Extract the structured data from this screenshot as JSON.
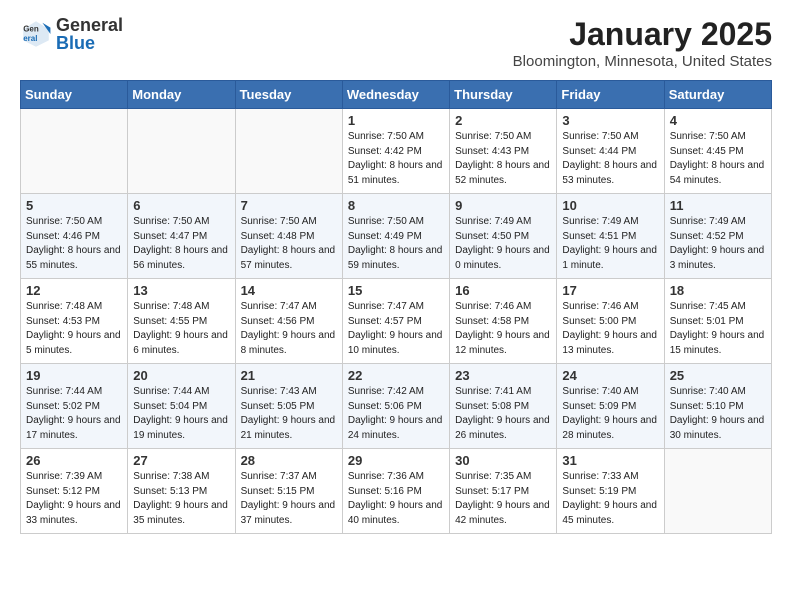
{
  "header": {
    "logo_general": "General",
    "logo_blue": "Blue",
    "month": "January 2025",
    "location": "Bloomington, Minnesota, United States"
  },
  "weekdays": [
    "Sunday",
    "Monday",
    "Tuesday",
    "Wednesday",
    "Thursday",
    "Friday",
    "Saturday"
  ],
  "weeks": [
    [
      {
        "day": "",
        "info": ""
      },
      {
        "day": "",
        "info": ""
      },
      {
        "day": "",
        "info": ""
      },
      {
        "day": "1",
        "info": "Sunrise: 7:50 AM\nSunset: 4:42 PM\nDaylight: 8 hours and 51 minutes."
      },
      {
        "day": "2",
        "info": "Sunrise: 7:50 AM\nSunset: 4:43 PM\nDaylight: 8 hours and 52 minutes."
      },
      {
        "day": "3",
        "info": "Sunrise: 7:50 AM\nSunset: 4:44 PM\nDaylight: 8 hours and 53 minutes."
      },
      {
        "day": "4",
        "info": "Sunrise: 7:50 AM\nSunset: 4:45 PM\nDaylight: 8 hours and 54 minutes."
      }
    ],
    [
      {
        "day": "5",
        "info": "Sunrise: 7:50 AM\nSunset: 4:46 PM\nDaylight: 8 hours and 55 minutes."
      },
      {
        "day": "6",
        "info": "Sunrise: 7:50 AM\nSunset: 4:47 PM\nDaylight: 8 hours and 56 minutes."
      },
      {
        "day": "7",
        "info": "Sunrise: 7:50 AM\nSunset: 4:48 PM\nDaylight: 8 hours and 57 minutes."
      },
      {
        "day": "8",
        "info": "Sunrise: 7:50 AM\nSunset: 4:49 PM\nDaylight: 8 hours and 59 minutes."
      },
      {
        "day": "9",
        "info": "Sunrise: 7:49 AM\nSunset: 4:50 PM\nDaylight: 9 hours and 0 minutes."
      },
      {
        "day": "10",
        "info": "Sunrise: 7:49 AM\nSunset: 4:51 PM\nDaylight: 9 hours and 1 minute."
      },
      {
        "day": "11",
        "info": "Sunrise: 7:49 AM\nSunset: 4:52 PM\nDaylight: 9 hours and 3 minutes."
      }
    ],
    [
      {
        "day": "12",
        "info": "Sunrise: 7:48 AM\nSunset: 4:53 PM\nDaylight: 9 hours and 5 minutes."
      },
      {
        "day": "13",
        "info": "Sunrise: 7:48 AM\nSunset: 4:55 PM\nDaylight: 9 hours and 6 minutes."
      },
      {
        "day": "14",
        "info": "Sunrise: 7:47 AM\nSunset: 4:56 PM\nDaylight: 9 hours and 8 minutes."
      },
      {
        "day": "15",
        "info": "Sunrise: 7:47 AM\nSunset: 4:57 PM\nDaylight: 9 hours and 10 minutes."
      },
      {
        "day": "16",
        "info": "Sunrise: 7:46 AM\nSunset: 4:58 PM\nDaylight: 9 hours and 12 minutes."
      },
      {
        "day": "17",
        "info": "Sunrise: 7:46 AM\nSunset: 5:00 PM\nDaylight: 9 hours and 13 minutes."
      },
      {
        "day": "18",
        "info": "Sunrise: 7:45 AM\nSunset: 5:01 PM\nDaylight: 9 hours and 15 minutes."
      }
    ],
    [
      {
        "day": "19",
        "info": "Sunrise: 7:44 AM\nSunset: 5:02 PM\nDaylight: 9 hours and 17 minutes."
      },
      {
        "day": "20",
        "info": "Sunrise: 7:44 AM\nSunset: 5:04 PM\nDaylight: 9 hours and 19 minutes."
      },
      {
        "day": "21",
        "info": "Sunrise: 7:43 AM\nSunset: 5:05 PM\nDaylight: 9 hours and 21 minutes."
      },
      {
        "day": "22",
        "info": "Sunrise: 7:42 AM\nSunset: 5:06 PM\nDaylight: 9 hours and 24 minutes."
      },
      {
        "day": "23",
        "info": "Sunrise: 7:41 AM\nSunset: 5:08 PM\nDaylight: 9 hours and 26 minutes."
      },
      {
        "day": "24",
        "info": "Sunrise: 7:40 AM\nSunset: 5:09 PM\nDaylight: 9 hours and 28 minutes."
      },
      {
        "day": "25",
        "info": "Sunrise: 7:40 AM\nSunset: 5:10 PM\nDaylight: 9 hours and 30 minutes."
      }
    ],
    [
      {
        "day": "26",
        "info": "Sunrise: 7:39 AM\nSunset: 5:12 PM\nDaylight: 9 hours and 33 minutes."
      },
      {
        "day": "27",
        "info": "Sunrise: 7:38 AM\nSunset: 5:13 PM\nDaylight: 9 hours and 35 minutes."
      },
      {
        "day": "28",
        "info": "Sunrise: 7:37 AM\nSunset: 5:15 PM\nDaylight: 9 hours and 37 minutes."
      },
      {
        "day": "29",
        "info": "Sunrise: 7:36 AM\nSunset: 5:16 PM\nDaylight: 9 hours and 40 minutes."
      },
      {
        "day": "30",
        "info": "Sunrise: 7:35 AM\nSunset: 5:17 PM\nDaylight: 9 hours and 42 minutes."
      },
      {
        "day": "31",
        "info": "Sunrise: 7:33 AM\nSunset: 5:19 PM\nDaylight: 9 hours and 45 minutes."
      },
      {
        "day": "",
        "info": ""
      }
    ]
  ]
}
